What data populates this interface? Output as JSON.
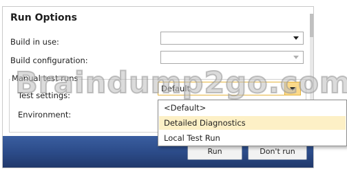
{
  "dialog": {
    "title": "Run Options",
    "fields": {
      "build_in_use": "Build in use:",
      "build_configuration": "Build configuration:",
      "manual_test_runs": "Manual test runs",
      "test_settings": "Test settings:",
      "test_settings_value": "Default",
      "environment": "Environment:"
    },
    "dropdown_options": [
      "<Default>",
      "Detailed Diagnostics",
      "Local Test Run"
    ],
    "highlighted_option_index": 1,
    "buttons": {
      "run": "Run",
      "dont_run": "Don't run"
    }
  },
  "watermark": "Braindump2go.com",
  "colors": {
    "footer": "#2b4a87",
    "highlight": "#fdf0c6",
    "combo_focus_border": "#e5b33c"
  },
  "icons": {
    "combo_arrow": "chevron-down-icon"
  }
}
